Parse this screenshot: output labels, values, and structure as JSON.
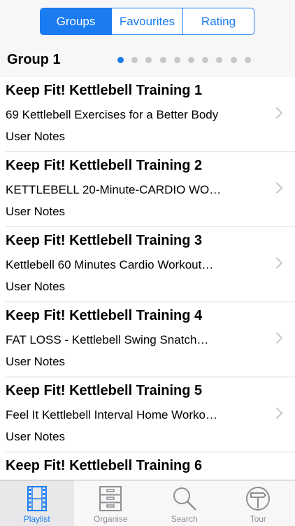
{
  "segmented_control": {
    "items": [
      {
        "label": "Groups",
        "selected": true
      },
      {
        "label": "Favourites",
        "selected": false
      },
      {
        "label": "Rating",
        "selected": false
      }
    ]
  },
  "group": {
    "title": "Group 1",
    "page_indicator": {
      "total": 10,
      "current": 1
    }
  },
  "playlist": [
    {
      "title": "Keep Fit! Kettlebell Training 1",
      "subtitle": "69 Kettlebell Exercises for a Better Body",
      "notes": "User Notes"
    },
    {
      "title": "Keep Fit! Kettlebell Training 2",
      "subtitle": "KETTLEBELL 20-Minute-CARDIO WO…",
      "notes": "User Notes"
    },
    {
      "title": "Keep Fit! Kettlebell Training 3",
      "subtitle": "Kettlebell 60 Minutes Cardio Workout…",
      "notes": "User Notes"
    },
    {
      "title": "Keep Fit! Kettlebell Training 4",
      "subtitle": "FAT LOSS - Kettlebell Swing Snatch…",
      "notes": "User Notes"
    },
    {
      "title": "Keep Fit! Kettlebell Training 5",
      "subtitle": "Feel It Kettlebell Interval Home Worko…",
      "notes": "User Notes"
    },
    {
      "title": "Keep Fit! Kettlebell Training 6",
      "subtitle": "",
      "notes": ""
    }
  ],
  "tab_bar": {
    "items": [
      {
        "label": "Playlist",
        "icon": "film-strip-icon",
        "selected": true
      },
      {
        "label": "Organise",
        "icon": "filing-cabinet-icon",
        "selected": false
      },
      {
        "label": "Search",
        "icon": "magnifier-icon",
        "selected": false
      },
      {
        "label": "Tour",
        "icon": "signpost-icon",
        "selected": false
      }
    ]
  },
  "colors": {
    "accent": "#1a7cf0",
    "inactive": "#8e8e93",
    "separator": "#d6d6d9"
  }
}
